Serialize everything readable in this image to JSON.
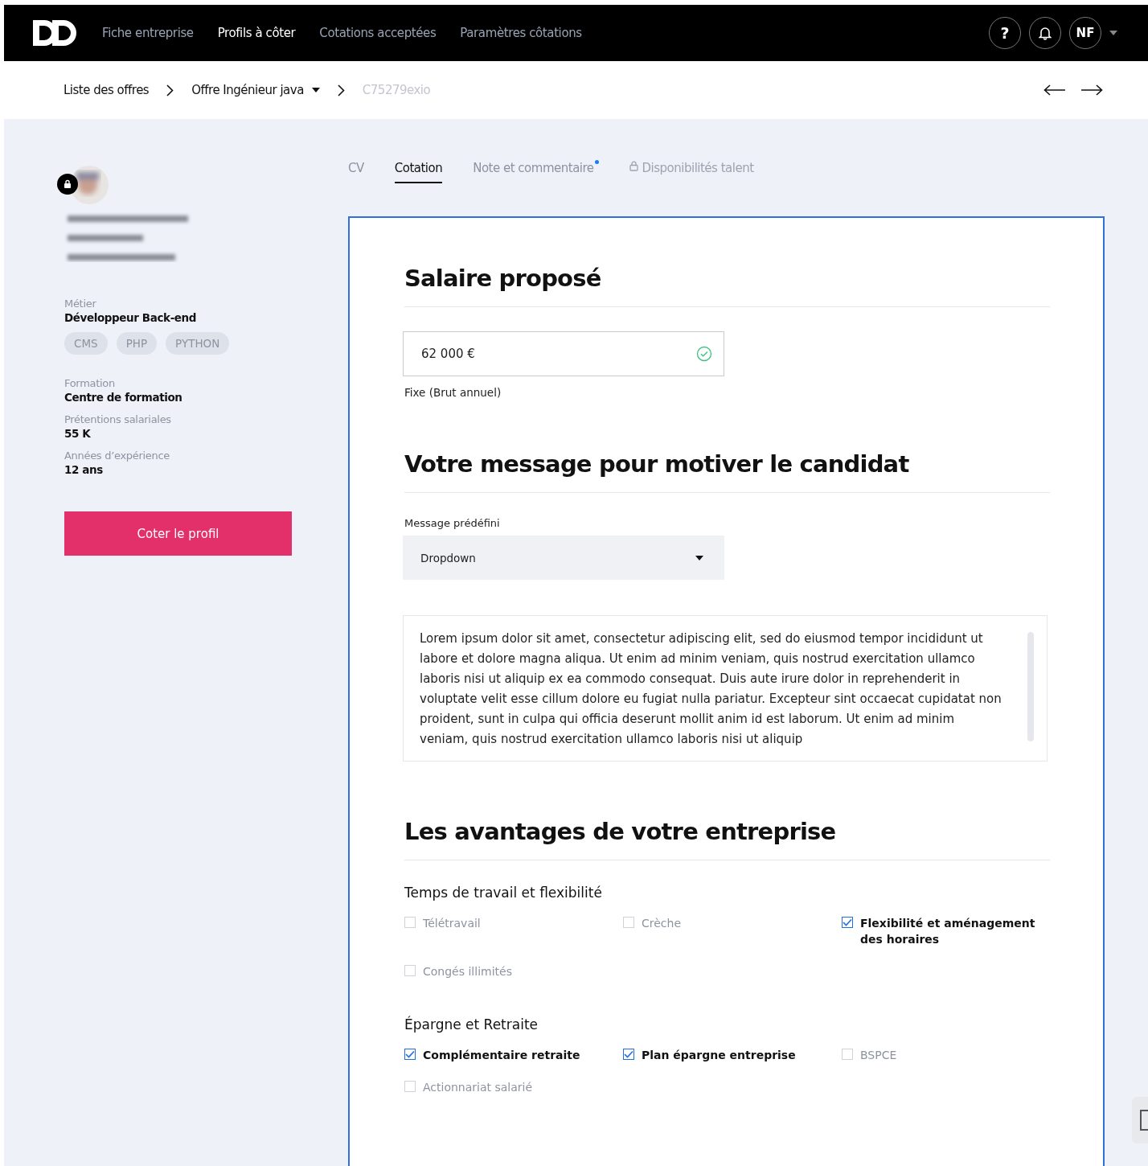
{
  "nav": {
    "items": [
      {
        "label": "Fiche entreprise",
        "selected": false
      },
      {
        "label": "Profils à côter",
        "selected": true
      },
      {
        "label": "Cotations acceptées",
        "selected": false
      },
      {
        "label": "Paramètres côtations",
        "selected": false
      }
    ],
    "help": "?",
    "initials": "NF"
  },
  "breadcrumb": {
    "items": [
      {
        "label": "Liste des offres",
        "kind": "link"
      },
      {
        "label": "Offre Ingénieur java",
        "kind": "dropdown"
      },
      {
        "label": "C75279exio",
        "kind": "current"
      }
    ]
  },
  "profile": {
    "locked": true,
    "job": {
      "label": "Métier",
      "value": "Développeur Back-end"
    },
    "skills": [
      "CMS",
      "PHP",
      "PYTHON"
    ],
    "facts": [
      {
        "label": "Formation",
        "value": "Centre de formation"
      },
      {
        "label": "Prétentions salariales",
        "value": "55 K"
      },
      {
        "label": "Années d’expérience",
        "value": "12 ans"
      }
    ],
    "button": "Coter le profil"
  },
  "tabs": [
    {
      "label": "CV",
      "selected": false,
      "notification": false,
      "disabled": false
    },
    {
      "label": "Cotation",
      "selected": true,
      "notification": false,
      "disabled": false
    },
    {
      "label": "Note et commentaire",
      "selected": false,
      "notification": true,
      "disabled": false
    },
    {
      "label": "Disponibilités talent",
      "selected": false,
      "notification": false,
      "disabled": true
    }
  ],
  "salary": {
    "title": "Salaire proposé",
    "value": "62 000 €",
    "valid": true,
    "caption": "Fixe (Brut annuel)"
  },
  "message": {
    "title": "Votre message pour motiver le candidat",
    "dropdown_label": "Message prédéfini",
    "dropdown_value": "Dropdown",
    "text": "Lorem ipsum dolor sit amet, consectetur adipiscing elit, sed do eiusmod tempor incididunt ut labore et dolore magna aliqua. Ut enim ad minim veniam, quis nostrud exercitation ullamco laboris nisi ut aliquip ex ea commodo consequat. Duis aute irure dolor in reprehenderit in voluptate velit esse cillum dolore eu fugiat nulla pariatur. Excepteur sint occaecat cupidatat non proident, sunt in culpa qui officia deserunt mollit anim id est laborum. Ut enim ad minim veniam, quis nostrud exercitation ullamco laboris nisi ut aliquip"
  },
  "benefits": {
    "title": "Les avantages de votre entreprise",
    "groups": [
      {
        "title": "Temps de travail et flexibilité",
        "items": [
          {
            "label": "Télétravail",
            "checked": false
          },
          {
            "label": "Crèche",
            "checked": false
          },
          {
            "label": "Flexibilité et aménagement des horaires",
            "checked": true
          },
          {
            "label": "Congés illimités",
            "checked": false
          }
        ]
      },
      {
        "title": "Épargne et Retraite",
        "items": [
          {
            "label": "Complémentaire retraite",
            "checked": true
          },
          {
            "label": "Plan épargne entreprise",
            "checked": true
          },
          {
            "label": "BSPCE",
            "checked": false
          },
          {
            "label": "Actionnariat salarié",
            "checked": false
          }
        ]
      }
    ]
  }
}
